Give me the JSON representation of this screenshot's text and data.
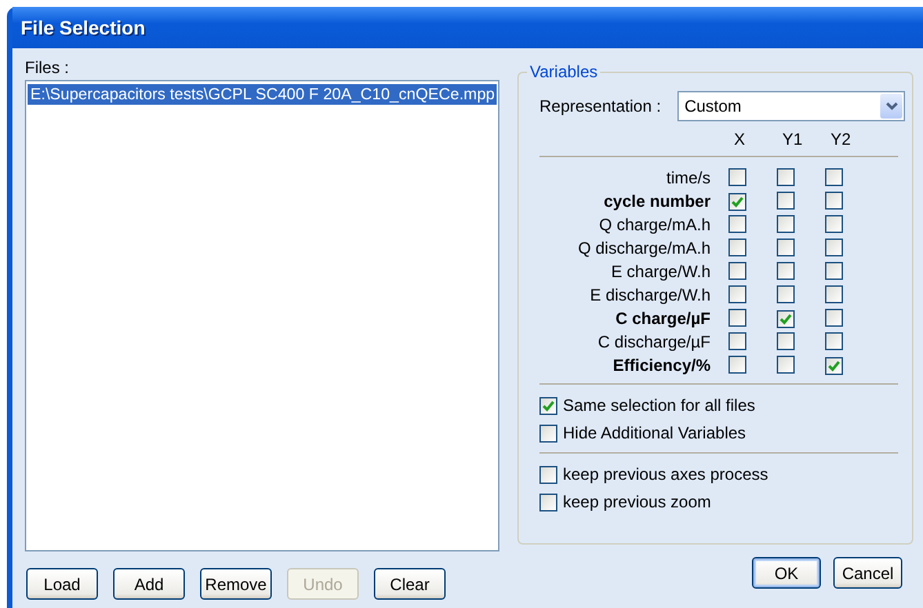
{
  "window": {
    "title": "File Selection"
  },
  "files": {
    "label": "Files :",
    "items": [
      {
        "path": "E:\\Supercapacitors tests\\GCPL SC400 F 20A_C10_cnQECe.mpp",
        "selected": true
      }
    ]
  },
  "file_buttons": [
    {
      "label": "Load",
      "disabled": false
    },
    {
      "label": "Add",
      "disabled": false
    },
    {
      "label": "Remove",
      "disabled": false
    },
    {
      "label": "Undo",
      "disabled": true
    },
    {
      "label": "Clear",
      "disabled": false
    }
  ],
  "variables": {
    "title": "Variables",
    "representation_label": "Representation :",
    "representation_value": "Custom",
    "columns": [
      "X",
      "Y1",
      "Y2"
    ],
    "rows": [
      {
        "name": "time/s",
        "bold": false,
        "checks": [
          false,
          false,
          false
        ]
      },
      {
        "name": "cycle number",
        "bold": true,
        "checks": [
          true,
          false,
          false
        ]
      },
      {
        "name": "Q charge/mA.h",
        "bold": false,
        "checks": [
          false,
          false,
          false
        ]
      },
      {
        "name": "Q discharge/mA.h",
        "bold": false,
        "checks": [
          false,
          false,
          false
        ]
      },
      {
        "name": "E charge/W.h",
        "bold": false,
        "checks": [
          false,
          false,
          false
        ]
      },
      {
        "name": "E discharge/W.h",
        "bold": false,
        "checks": [
          false,
          false,
          false
        ]
      },
      {
        "name": "C charge/µF",
        "bold": true,
        "checks": [
          false,
          true,
          false
        ]
      },
      {
        "name": "C discharge/µF",
        "bold": false,
        "checks": [
          false,
          false,
          false
        ]
      },
      {
        "name": "Efficiency/%",
        "bold": true,
        "checks": [
          false,
          false,
          true
        ]
      }
    ],
    "options": [
      {
        "label": "Same selection for all files",
        "checked": true
      },
      {
        "label": "Hide Additional Variables",
        "checked": false
      }
    ],
    "keep_options": [
      {
        "label": "keep previous axes process",
        "checked": false
      },
      {
        "label": "keep previous zoom",
        "checked": false
      }
    ]
  },
  "dialog_buttons": [
    {
      "label": "OK",
      "default": true
    },
    {
      "label": "Cancel",
      "default": false
    }
  ]
}
